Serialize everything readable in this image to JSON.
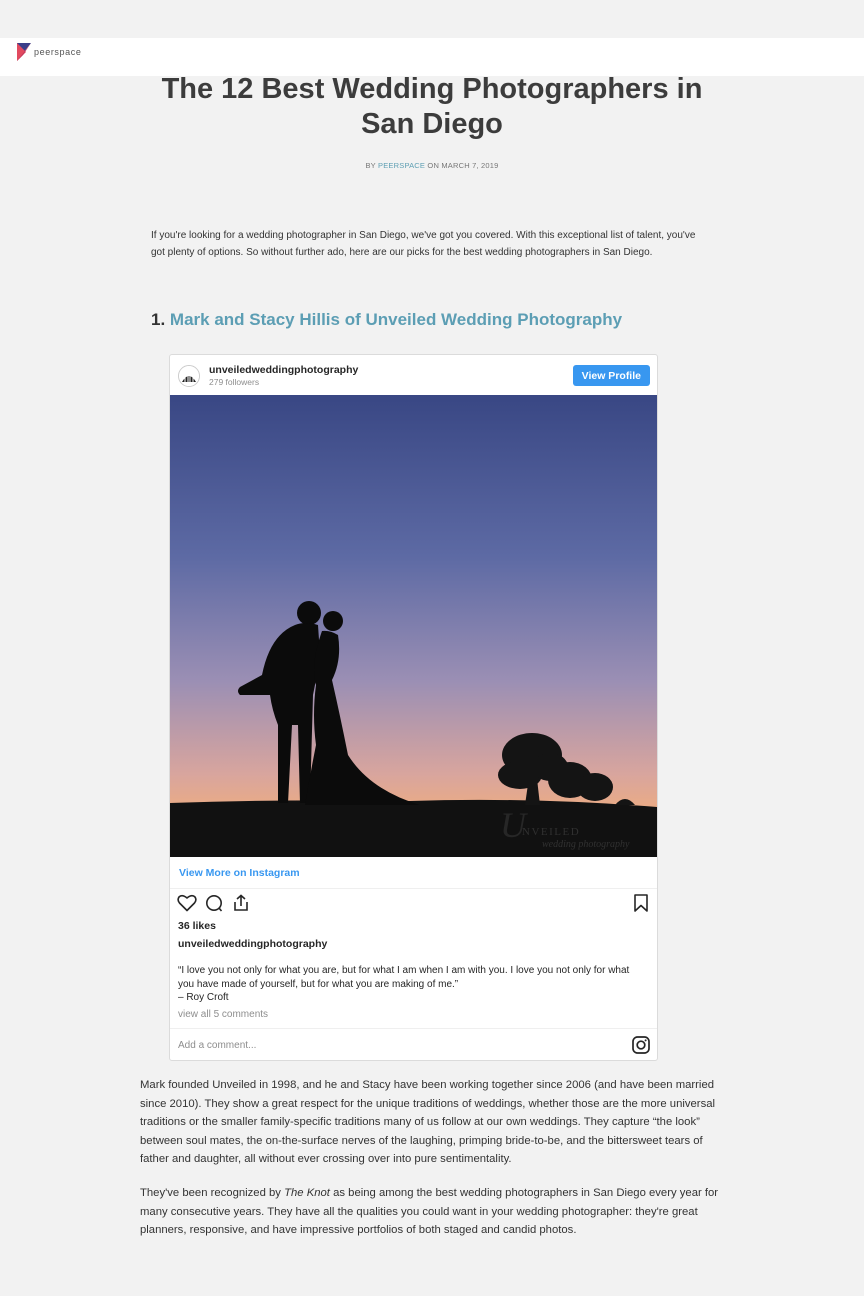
{
  "header": {
    "brand": "peerspace",
    "logo_icon": "peerspace-logo-icon"
  },
  "article": {
    "title": "The 12 Best Wedding Photographers in San Diego",
    "byline_prefix": "BY",
    "author": "PEERSPACE",
    "date_text": "ON MARCH 7, 2019",
    "intro": "If you're looking for a wedding photographer in San Diego, we've got you covered. With this exceptional list of talent, you've got plenty of options. So without further ado, here are our picks for the best wedding photographers in San Diego.",
    "section1": {
      "number": "1.",
      "link_text": "Mark and Stacy Hillis of Unveiled Wedding Photography"
    },
    "para1": "Mark founded Unveiled in 1998, and he and Stacy have been working together since 2006 (and have been married since 2010). They show a great respect for the unique traditions of weddings, whether those are the more universal traditions or the smaller family-specific traditions many of us follow at our own weddings. They capture “the look” between soul mates, the on-the-surface nerves of the laughing, primping bride-to-be, and the bittersweet tears of father and daughter, all without ever crossing over into pure sentimentality.",
    "para2_before": "They've been recognized by ",
    "para2_em": "The Knot",
    "para2_after": " as being among the best wedding photographers in San Diego every year for many consecutive years. They have all the qualities you could want in your wedding photographer: they're great planners, responsive, and have impressive portfolios of both staged and candid photos."
  },
  "instagram": {
    "username": "unveiledweddingphotography",
    "followers": "279 followers",
    "view_profile": "View Profile",
    "view_more": "View More on Instagram",
    "likes": "36 likes",
    "caption_user": "unveiledweddingphotography",
    "caption_line1": "“I love you not only for what you are, but for what I am when I am with you. I love you not only for what you have made of yourself, but for what you are making of me.”",
    "caption_line2": "– Roy Croft",
    "view_comments": "view all 5 comments",
    "add_comment_placeholder": "Add a comment...",
    "watermark_line1": "NVEILED",
    "watermark_line2": "wedding photography",
    "watermark_initial": "U",
    "colors": {
      "accent": "#3897f0",
      "sky_top": "#3c4a86",
      "sky_bottom": "#f0a878"
    }
  }
}
